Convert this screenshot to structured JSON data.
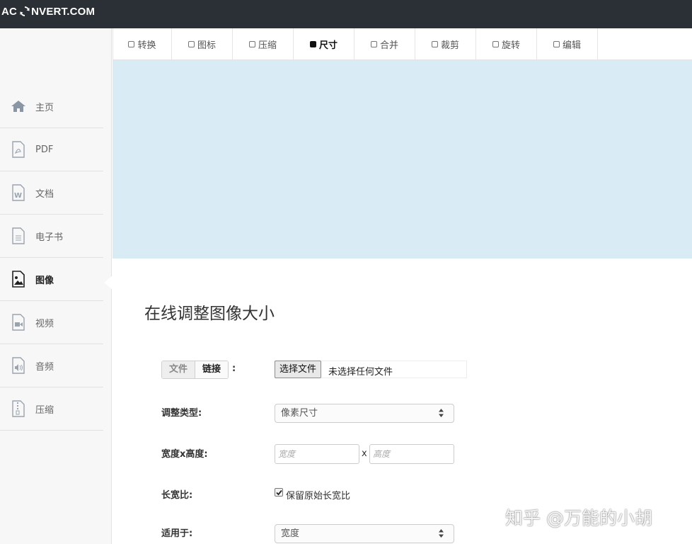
{
  "header": {
    "logo_left": "AC",
    "logo_right": "NVERT.COM",
    "logo_icon": "refresh-circle-icon"
  },
  "tabs": [
    {
      "label": "转换",
      "active": false
    },
    {
      "label": "图标",
      "active": false
    },
    {
      "label": "压缩",
      "active": false
    },
    {
      "label": "尺寸",
      "active": true
    },
    {
      "label": "合并",
      "active": false
    },
    {
      "label": "裁剪",
      "active": false
    },
    {
      "label": "旋转",
      "active": false
    },
    {
      "label": "编辑",
      "active": false
    }
  ],
  "sidebar": {
    "items": [
      {
        "label": "主页",
        "icon": "home-icon"
      },
      {
        "label": "PDF",
        "icon": "pdf-file-icon"
      },
      {
        "label": "文档",
        "icon": "word-document-icon"
      },
      {
        "label": "电子书",
        "icon": "ebook-file-icon"
      },
      {
        "label": "图像",
        "icon": "image-file-icon",
        "active": true
      },
      {
        "label": "视频",
        "icon": "video-file-icon"
      },
      {
        "label": "音频",
        "icon": "audio-file-icon"
      },
      {
        "label": "压缩",
        "icon": "archive-file-icon"
      }
    ]
  },
  "main": {
    "title": "在线调整图像大小",
    "source": {
      "file_tab": "文件",
      "link_tab": "链接",
      "colon": ":",
      "choose_button": "选择文件",
      "no_file_text": "未选择任何文件"
    },
    "resize_type": {
      "label": "调整类型:",
      "value": "像素尺寸"
    },
    "dimensions": {
      "label": "宽度x高度:",
      "width_placeholder": "宽度",
      "height_placeholder": "高度",
      "separator": "x"
    },
    "aspect": {
      "label": "长宽比:",
      "checkbox_label": "保留原始长宽比",
      "checked": true
    },
    "apply_to": {
      "label": "适用于:",
      "value": "宽度"
    }
  },
  "watermark": "知乎 @万能的小胡",
  "colors": {
    "topbar": "#2b2f36",
    "banner": "#d9ebf5",
    "sidebar": "#f7f7f7"
  }
}
